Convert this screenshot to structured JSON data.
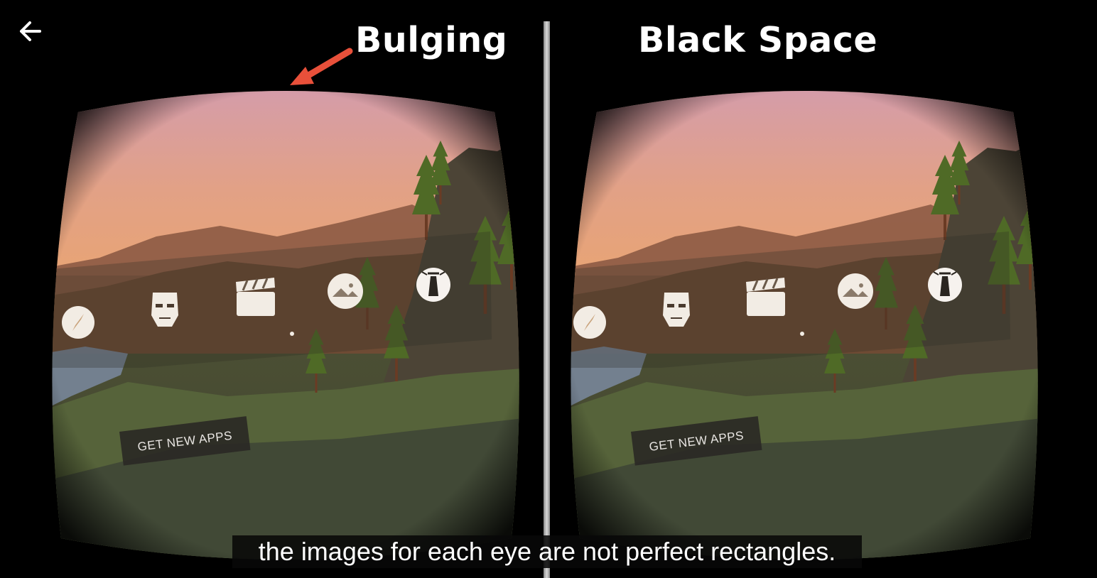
{
  "annotations": {
    "left_label": "Bulging",
    "right_label": "Black Space",
    "arrow_color": "#e8503a"
  },
  "vr_menu": {
    "icons": [
      "compass-icon",
      "face-mask-icon",
      "clapperboard-icon",
      "panorama-icon",
      "lighthouse-icon"
    ],
    "get_apps_label": "GET NEW APPS"
  },
  "caption": {
    "text": "the images for each eye are not perfect rectangles."
  },
  "colors": {
    "sky_top": "#d59aa8",
    "sky_bottom": "#e8a77a",
    "background": "#000000"
  }
}
